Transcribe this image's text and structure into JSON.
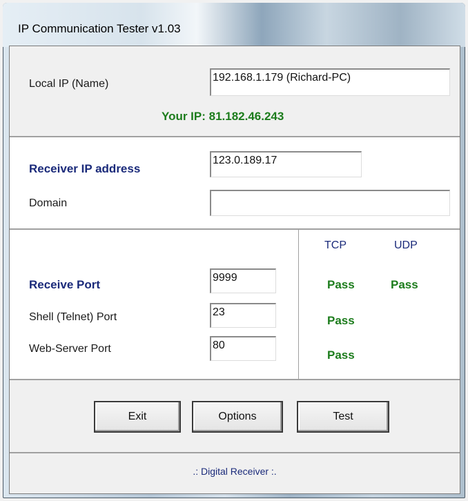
{
  "window": {
    "title": "IP Communication Tester v1.03"
  },
  "local": {
    "label": "Local IP (Name)",
    "value": "192.168.1.179 (Richard-PC)",
    "your_ip": "Your IP: 81.182.46.243"
  },
  "receiver": {
    "ip_label": "Receiver IP address",
    "ip_value": "123.0.189.17",
    "domain_label": "Domain",
    "domain_value": ""
  },
  "ports": {
    "tcp_header": "TCP",
    "udp_header": "UDP",
    "rows": [
      {
        "label": "Receive Port",
        "value": "9999",
        "tcp": "Pass",
        "udp": "Pass"
      },
      {
        "label": "Shell (Telnet) Port",
        "value": "23",
        "tcp": "Pass",
        "udp": ""
      },
      {
        "label": "Web-Server Port",
        "value": "80",
        "tcp": "Pass",
        "udp": ""
      }
    ]
  },
  "buttons": {
    "exit": "Exit",
    "options": "Options",
    "test": "Test"
  },
  "footer": {
    "text": ".: Digital Receiver :."
  },
  "colors": {
    "pass": "#1c7c1c",
    "label_blue": "#1a2a7a"
  }
}
